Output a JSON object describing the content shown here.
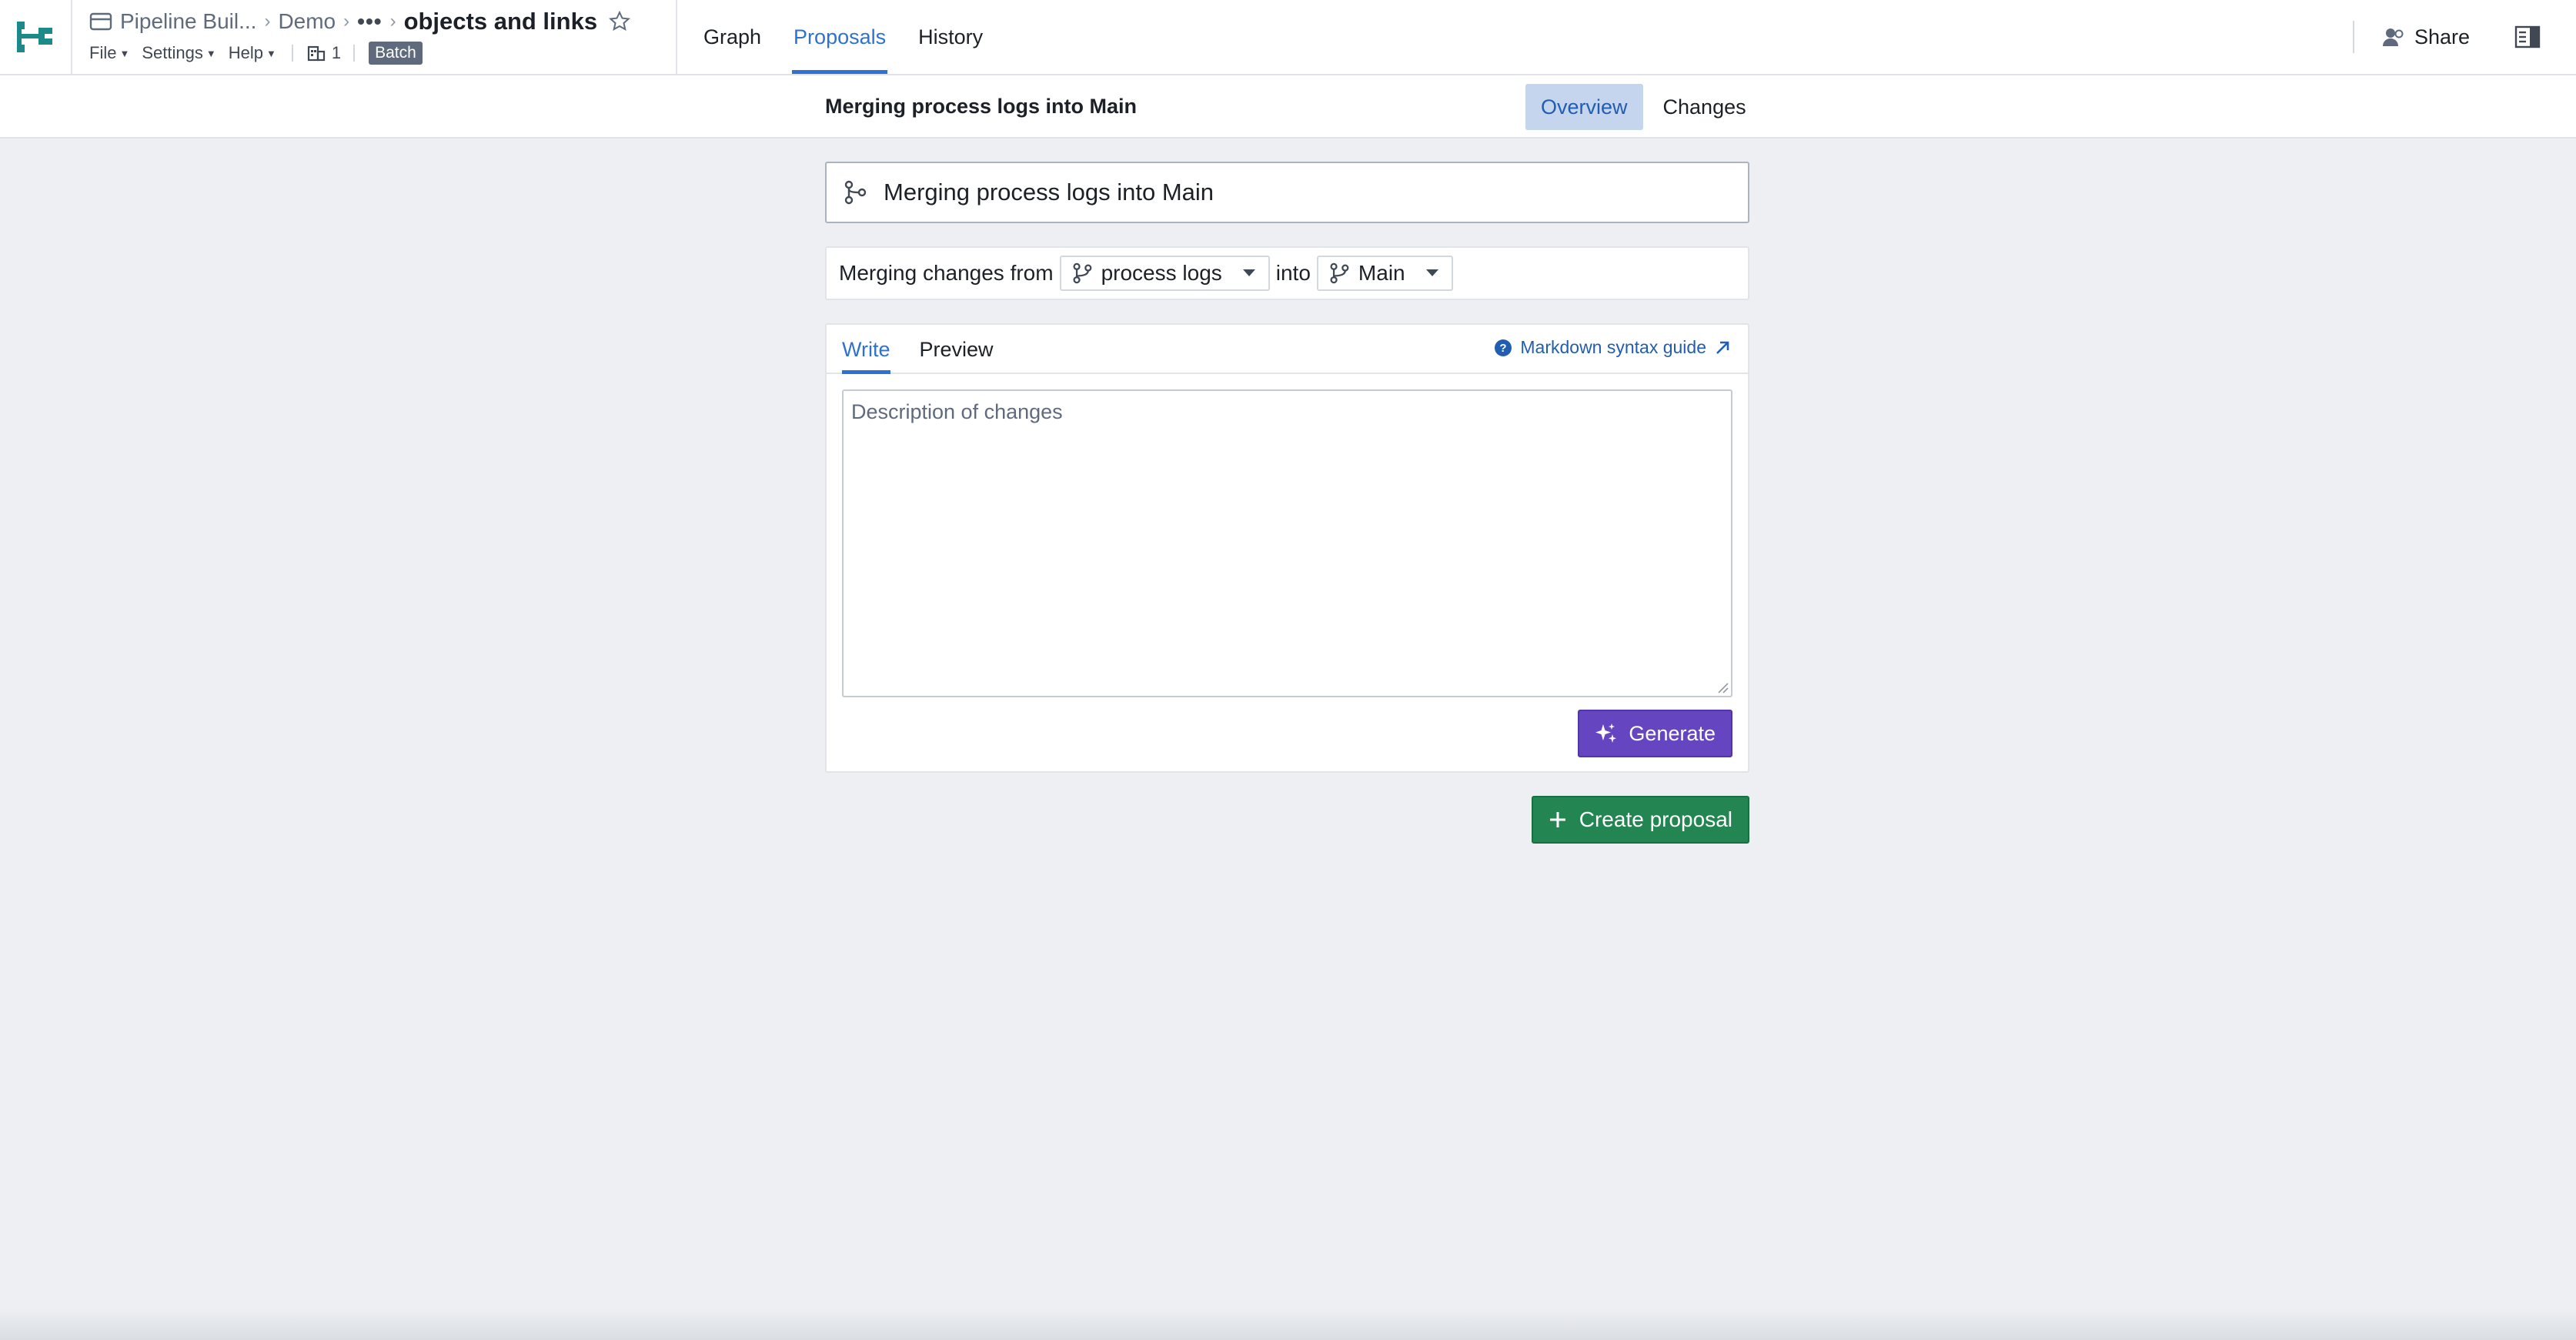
{
  "app": {
    "breadcrumbs": [
      "Pipeline Buil...",
      "Demo",
      "•••"
    ],
    "current_resource": "objects and links",
    "menu": {
      "file": "File",
      "settings": "Settings",
      "help": "Help"
    },
    "branch_count": "1",
    "mode_badge": "Batch"
  },
  "nav": {
    "tabs": [
      "Graph",
      "Proposals",
      "History"
    ],
    "active": "Proposals"
  },
  "actions": {
    "share": "Share"
  },
  "subheader": {
    "title": "Merging process logs into Main",
    "tabs": [
      "Overview",
      "Changes"
    ],
    "active": "Overview"
  },
  "proposal": {
    "title_value": "Merging process logs into Main",
    "merge_prefix": "Merging changes from",
    "source_branch": "process logs",
    "merge_into": "into",
    "target_branch": "Main"
  },
  "editor": {
    "tabs": [
      "Write",
      "Preview"
    ],
    "active": "Write",
    "markdown_link": "Markdown syntax guide",
    "description_placeholder": "Description of changes",
    "generate_label": "Generate"
  },
  "create_label": "Create proposal",
  "colors": {
    "accent": "#2d72d2",
    "generate": "#6546c0",
    "create": "#238551",
    "logo": "#1d8a8a"
  },
  "icons": [
    "pipeline-logo-icon",
    "resource-icon",
    "star-icon",
    "branch-icon",
    "caret-down-icon",
    "share-icon",
    "side-panel-icon",
    "help-icon",
    "external-link-icon",
    "sparkle-icon",
    "plus-icon"
  ]
}
